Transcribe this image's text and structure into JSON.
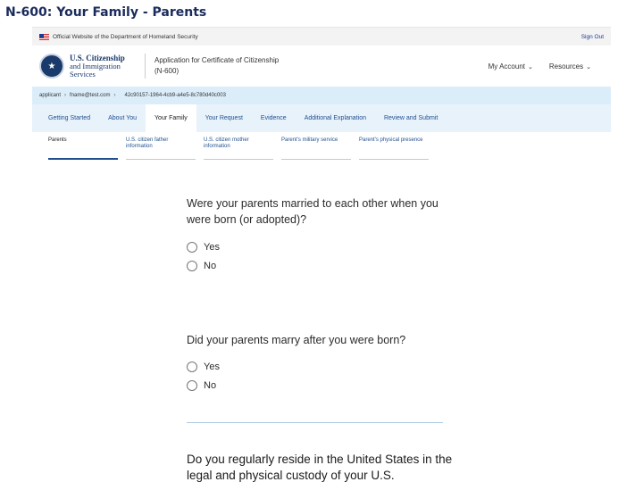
{
  "slide_title": "N-600: Your Family - Parents",
  "banner": {
    "text": "Official Website of the Department of Homeland Security",
    "sign_out": "Sign Out"
  },
  "header": {
    "agency_line1": "U.S. Citizenship",
    "agency_line2": "and Immigration",
    "agency_line3": "Services",
    "app_title_line1": "Application for Certificate of Citizenship",
    "app_title_line2": "(N-600)",
    "nav": [
      {
        "label": "My Account"
      },
      {
        "label": "Resources"
      }
    ]
  },
  "breadcrumb": {
    "applicant": "applicant",
    "email": "fname@test.com",
    "case_id": "42c90157-1964-4cb9-a4e5-8c780d40c003"
  },
  "tabs": [
    {
      "label": "Getting Started"
    },
    {
      "label": "About You"
    },
    {
      "label": "Your Family",
      "active": true
    },
    {
      "label": "Your Request"
    },
    {
      "label": "Evidence"
    },
    {
      "label": "Additional Explanation"
    },
    {
      "label": "Review and Submit"
    }
  ],
  "subtabs": [
    {
      "label": "Parents",
      "active": true
    },
    {
      "label": "U.S. citizen father information"
    },
    {
      "label": "U.S. citizen mother information"
    },
    {
      "label": "Parent's military service"
    },
    {
      "label": "Parent's physical presence"
    }
  ],
  "questions": [
    {
      "text": "Were your parents married to each other when you were born (or adopted)?",
      "options": [
        "Yes",
        "No"
      ]
    },
    {
      "text": "Did your parents marry after you were born?",
      "options": [
        "Yes",
        "No"
      ]
    },
    {
      "text": "Do you regularly reside in the United States in the legal and physical custody of your U.S."
    }
  ]
}
